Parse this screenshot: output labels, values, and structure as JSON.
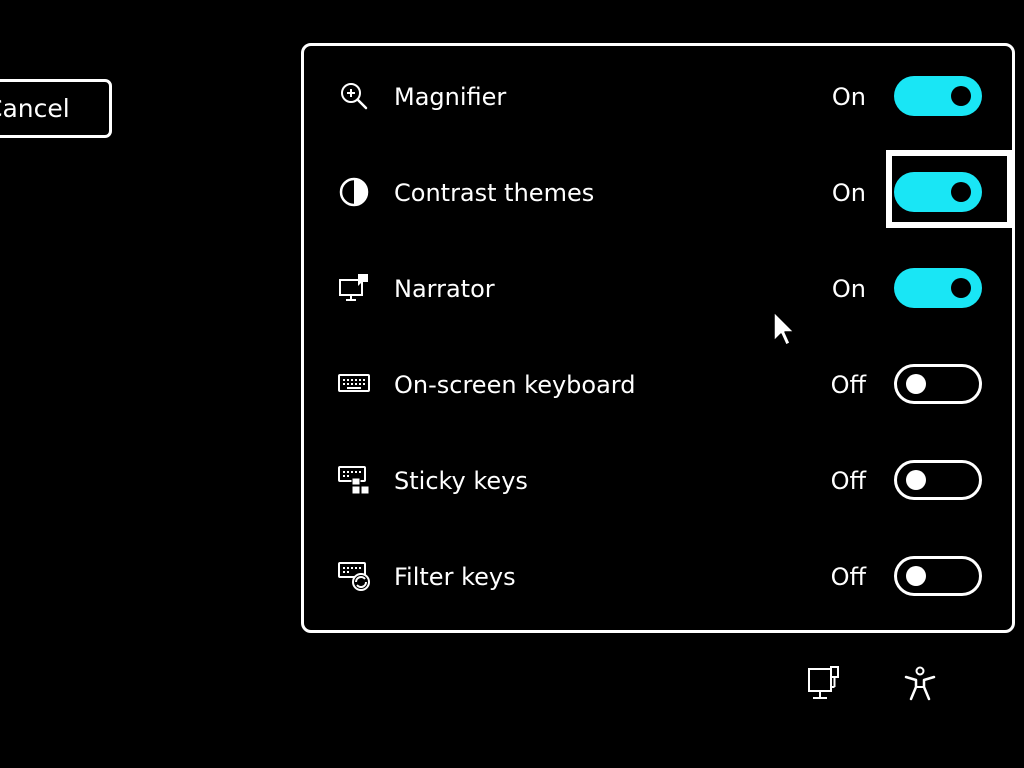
{
  "cancel_button": {
    "label": "Cancel"
  },
  "panel": {
    "items": [
      {
        "label": "Magnifier",
        "state": "On",
        "icon": "magnifier-icon",
        "on": true
      },
      {
        "label": "Contrast themes",
        "state": "On",
        "icon": "contrast-icon",
        "on": true
      },
      {
        "label": "Narrator",
        "state": "On",
        "icon": "narrator-icon",
        "on": true
      },
      {
        "label": "On-screen keyboard",
        "state": "Off",
        "icon": "keyboard-icon",
        "on": false
      },
      {
        "label": "Sticky keys",
        "state": "Off",
        "icon": "sticky-keys-icon",
        "on": false
      },
      {
        "label": "Filter keys",
        "state": "Off",
        "icon": "filter-keys-icon",
        "on": false
      }
    ]
  },
  "bottom_icons": [
    "network-icon",
    "accessibility-icon"
  ],
  "colors": {
    "accent": "#19e6f5",
    "background": "#000000",
    "foreground": "#ffffff"
  }
}
